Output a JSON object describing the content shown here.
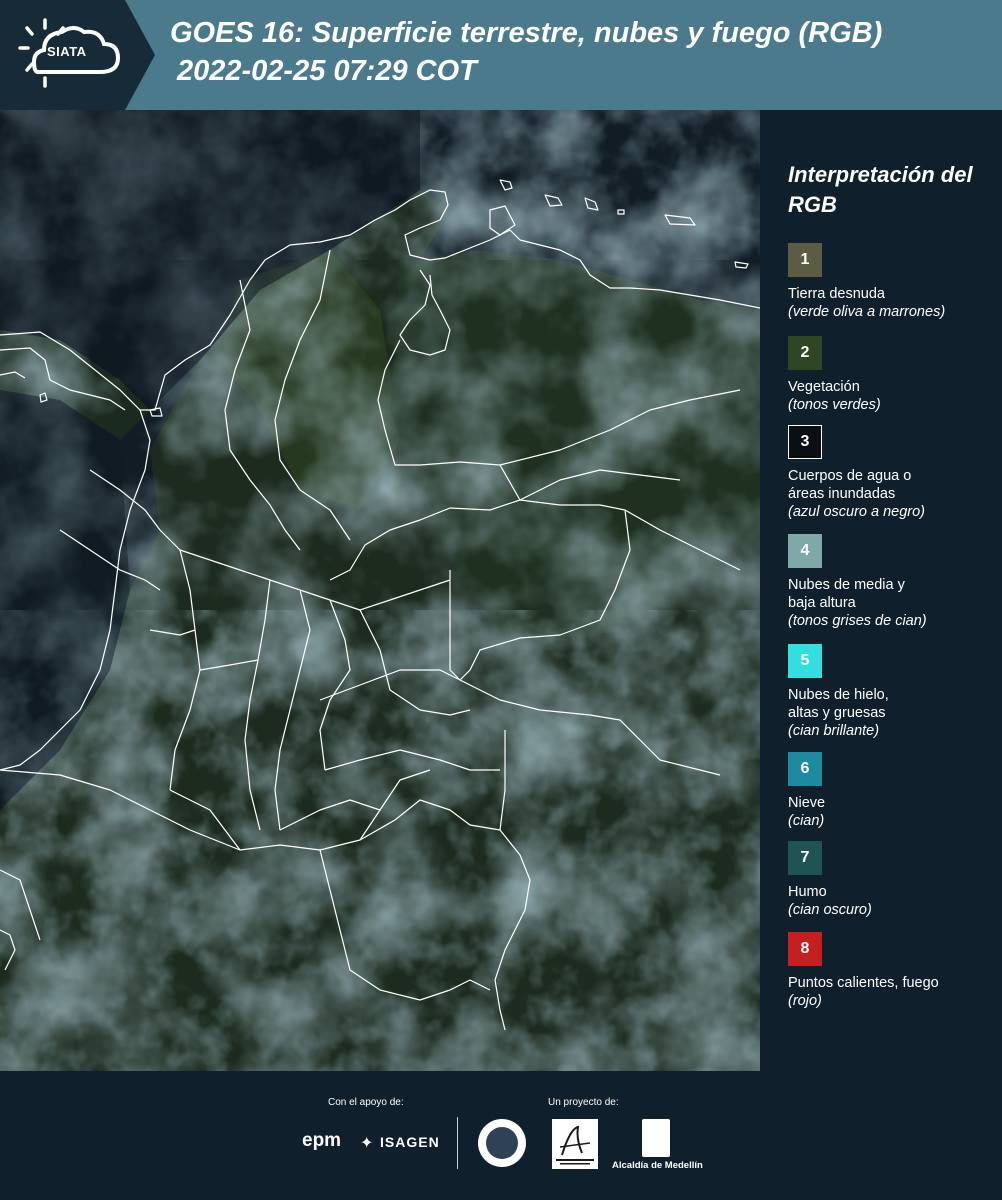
{
  "header": {
    "logo_text": "SIATA",
    "title_line1": "GOES 16: Superficie terrestre, nubes y fuego (RGB)",
    "title_line2": "2022-02-25 07:29 COT"
  },
  "legend": {
    "title": "Interpretación del RGB",
    "items": [
      {
        "number": "1",
        "label": "Tierra desnuda",
        "desc": "(verde oliva a marrones)",
        "color": "#5c5c44"
      },
      {
        "number": "2",
        "label": "Vegetación",
        "desc": "(tonos verdes)",
        "color": "#2f4524"
      },
      {
        "number": "3",
        "label": "Cuerpos de agua o\náreas inundadas",
        "desc": "(azul oscuro a negro)",
        "color": "#0a0f14"
      },
      {
        "number": "4",
        "label": "Nubes de media y\nbaja altura",
        "desc": "(tonos grises de cian)",
        "color": "#7fa9a9"
      },
      {
        "number": "5",
        "label": "Nubes de hielo,\naltas y gruesas",
        "desc": "(cian brillante)",
        "color": "#33dede"
      },
      {
        "number": "6",
        "label": "Nieve",
        "desc": "(cian)",
        "color": "#1e8aa0"
      },
      {
        "number": "7",
        "label": "Humo",
        "desc": "(cian oscuro)",
        "color": "#1f5452"
      },
      {
        "number": "8",
        "label": "Puntos calientes, fuego",
        "desc": "(rojo)",
        "color": "#c42020"
      }
    ]
  },
  "footer": {
    "support_label": "Con el apoyo de:",
    "project_label": "Un proyecto de:",
    "epm": "epm",
    "isagen": "ISAGEN",
    "alcaldia": "Alcaldía de Medellín"
  }
}
